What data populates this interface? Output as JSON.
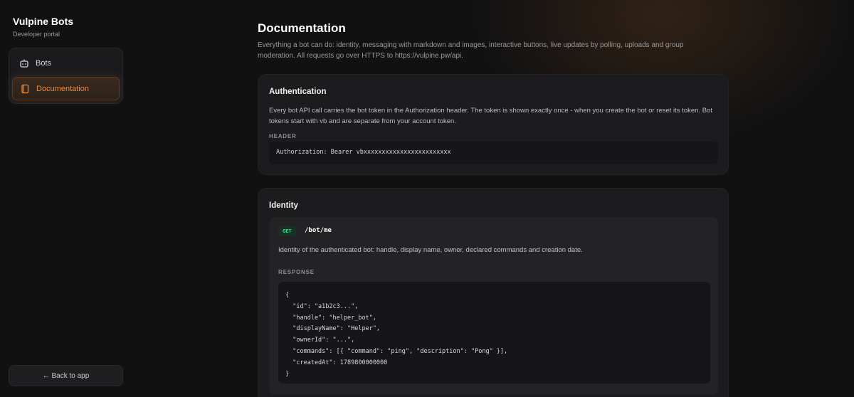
{
  "brand": {
    "title": "Vulpine Bots",
    "subtitle": "Developer portal"
  },
  "nav": {
    "items": [
      {
        "label": "Bots",
        "icon": "bot-icon",
        "active": false
      },
      {
        "label": "Documentation",
        "icon": "book-icon",
        "active": true
      }
    ],
    "back_label": "← Back to app"
  },
  "colors": {
    "accent": "#f28a3c",
    "get_badge_bg": "#173326",
    "get_badge_text": "#4fd08e",
    "background": "#111112",
    "card": "#1c1c1e"
  },
  "page": {
    "title": "Documentation",
    "description": "Everything a bot can do: identity, messaging with markdown and images, interactive buttons, live updates by polling, uploads and group moderation. All requests go over HTTPS to https://vulpine.pw/api."
  },
  "auth": {
    "title": "Authentication",
    "text": "Every bot API call carries the bot token in the Authorization header. The token is shown exactly once - when you create the bot or reset its token. Bot tokens start with vb and are separate from your account token.",
    "header_label": "HEADER",
    "header_value": "Authorization: Bearer vbxxxxxxxxxxxxxxxxxxxxxxxx"
  },
  "identity": {
    "title": "Identity",
    "method": "GET",
    "path": "/bot/me",
    "description": "Identity of the authenticated bot: handle, display name, owner, declared commands and creation date.",
    "response_label": "RESPONSE",
    "response_lines": [
      "{",
      "  \"id\": \"a1b2c3...\",",
      "  \"handle\": \"helper_bot\",",
      "  \"displayName\": \"Helper\",",
      "  \"ownerId\": \"...\",",
      "  \"commands\": [{ \"command\": \"ping\", \"description\": \"Pong\" }],",
      "  \"createdAt\": 1789800000000",
      "}"
    ]
  }
}
